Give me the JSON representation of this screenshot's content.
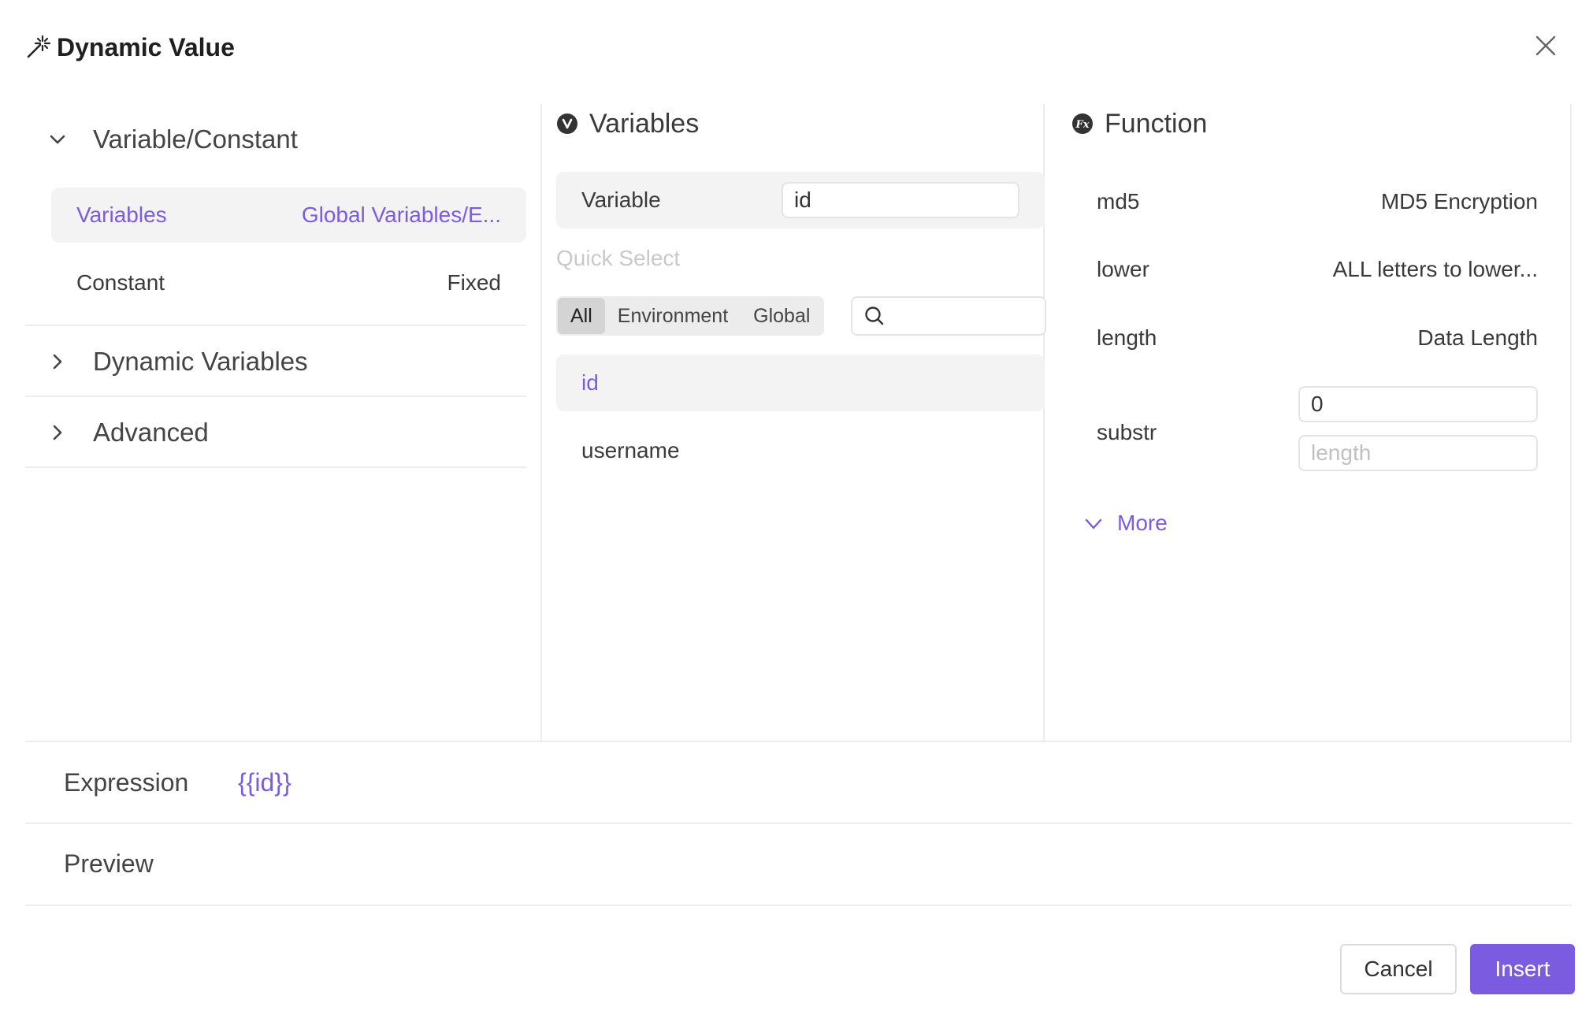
{
  "dialog": {
    "title": "Dynamic Value"
  },
  "left": {
    "groups": [
      {
        "label": "Variable/Constant"
      },
      {
        "label": "Dynamic Variables"
      },
      {
        "label": "Advanced"
      }
    ],
    "items": [
      {
        "name": "Variables",
        "desc": "Global Variables/E..."
      },
      {
        "name": "Constant",
        "desc": "Fixed"
      }
    ]
  },
  "variables": {
    "header": "Variables",
    "variable_label": "Variable",
    "variable_value": "id",
    "quick_select": "Quick Select",
    "filters": [
      "All",
      "Environment",
      "Global"
    ],
    "list": [
      "id",
      "username"
    ]
  },
  "function": {
    "header": "Function",
    "items": [
      {
        "name": "md5",
        "desc": "MD5 Encryption"
      },
      {
        "name": "lower",
        "desc": "ALL letters to lower..."
      },
      {
        "name": "length",
        "desc": "Data Length"
      },
      {
        "name": "substr"
      }
    ],
    "substr_start_value": "0",
    "substr_length_placeholder": "length",
    "more": "More"
  },
  "expression": {
    "label": "Expression",
    "value": "{{id}}"
  },
  "preview": {
    "label": "Preview"
  },
  "footer": {
    "cancel": "Cancel",
    "insert": "Insert"
  },
  "colors": {
    "accent": "#7b5ce0"
  }
}
